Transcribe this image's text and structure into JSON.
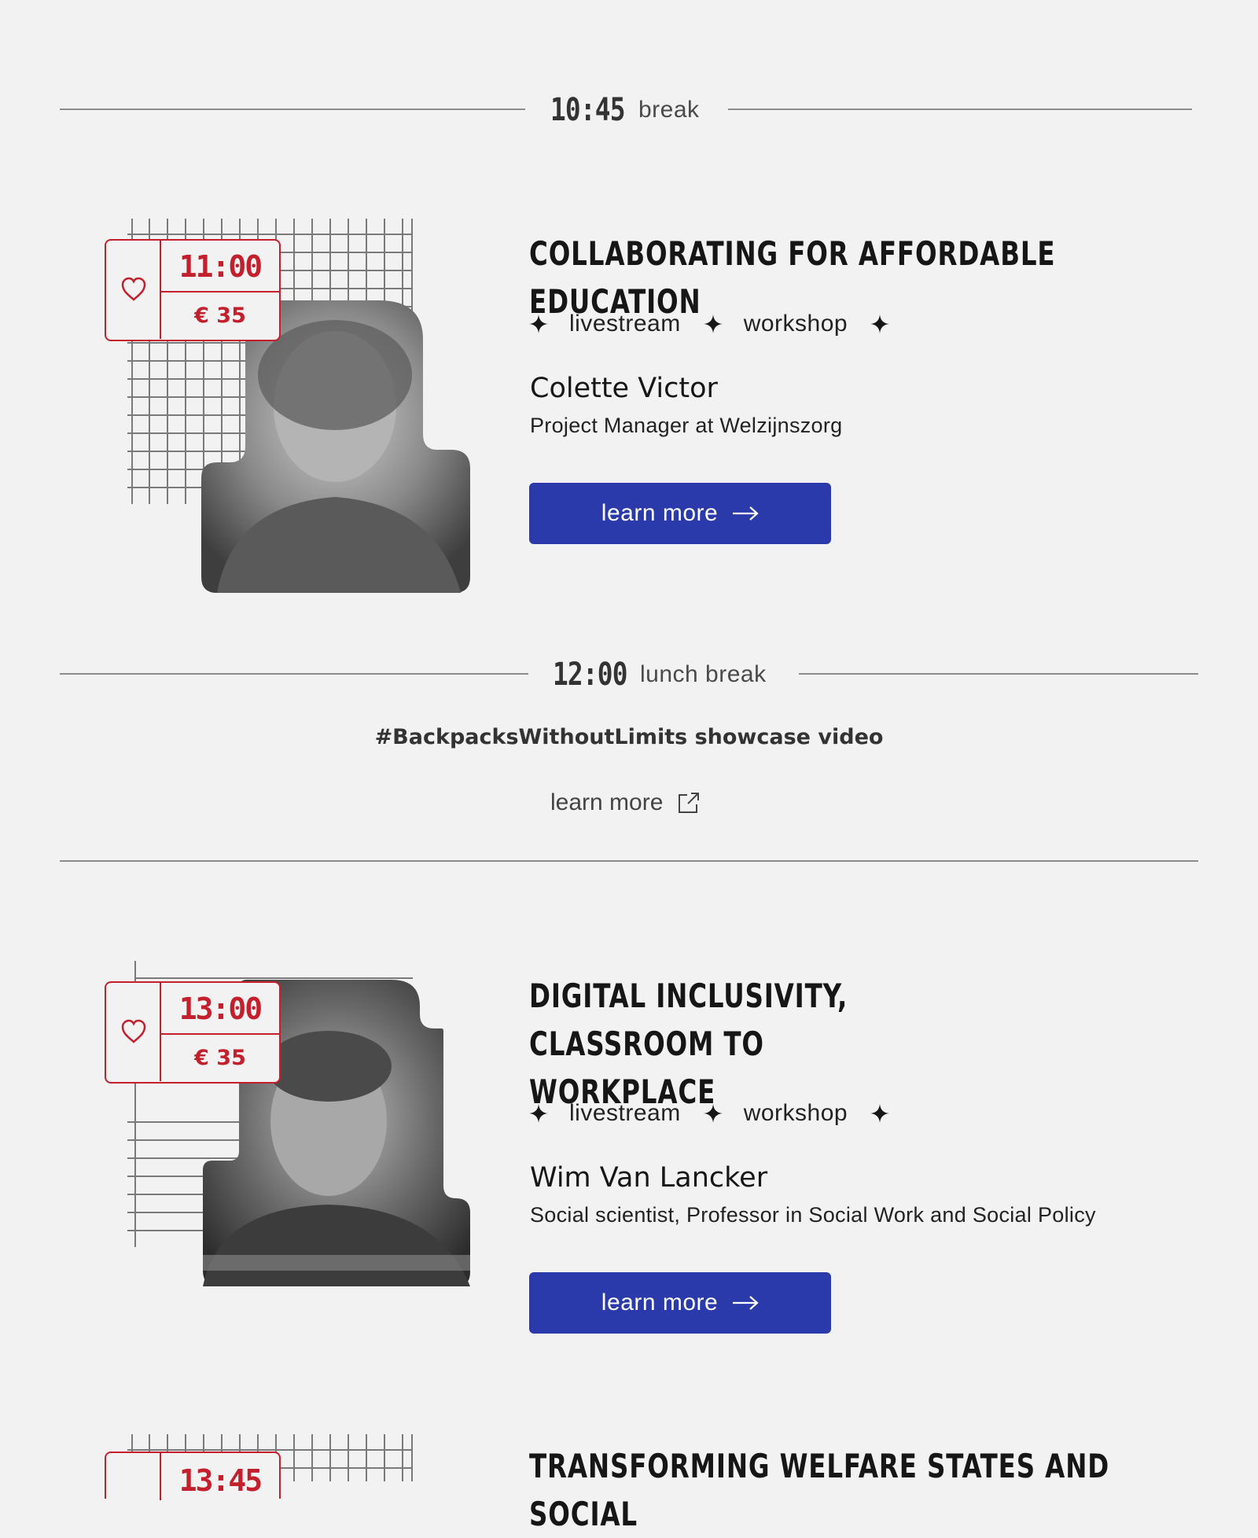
{
  "breaks": [
    {
      "time": "10:45",
      "label": "break"
    },
    {
      "time": "12:00",
      "label": "lunch break"
    }
  ],
  "lunch": {
    "showcase_title": "#BackpacksWithoutLimits showcase video",
    "link_label": "learn more"
  },
  "sessions": [
    {
      "time": "11:00",
      "price": "€ 35",
      "title": "COLLABORATING FOR AFFORDABLE EDUCATION",
      "tags": [
        "livestream",
        "workshop"
      ],
      "speaker": "Colette Victor",
      "role": "Project Manager at Welzijnszorg",
      "button": "learn more"
    },
    {
      "time": "13:00",
      "price": "€ 35",
      "title": "DIGITAL INCLUSIVITY, CLASSROOM TO WORKPLACE",
      "tags": [
        "livestream",
        "workshop"
      ],
      "speaker": "Wim Van Lancker",
      "role": "Social scientist, Professor in Social Work and Social Policy",
      "button": "learn more"
    },
    {
      "time": "13:45",
      "title": "TRANSFORMING WELFARE STATES AND SOCIAL"
    }
  ],
  "icons": {
    "favorite": "heart-outline-icon",
    "tag_separator": "four-point-star-icon",
    "button_arrow": "arrow-right-icon",
    "external": "external-link-icon"
  },
  "colors": {
    "background": "#f2f2f2",
    "accent_red": "#c41f2c",
    "button_blue": "#2b3aaa",
    "text_dark": "#161616"
  }
}
